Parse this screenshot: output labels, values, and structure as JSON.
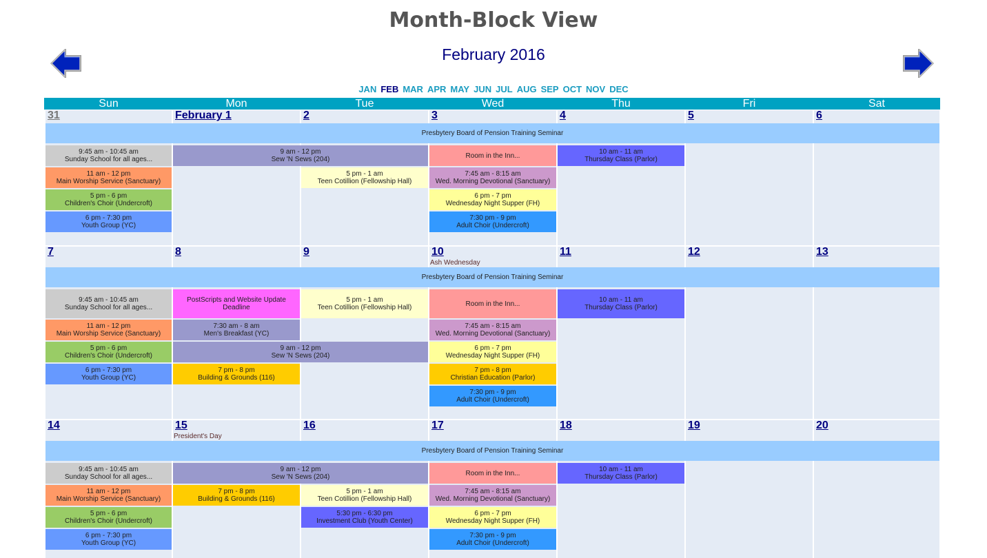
{
  "page": {
    "title": "Month-Block View",
    "month_title": "February 2016"
  },
  "nav": {
    "prev_icon": "left-arrow-icon",
    "next_icon": "right-arrow-icon"
  },
  "months": [
    "JAN",
    "FEB",
    "MAR",
    "APR",
    "MAY",
    "JUN",
    "JUL",
    "AUG",
    "SEP",
    "OCT",
    "NOV",
    "DEC"
  ],
  "current_month": "FEB",
  "weekdays": [
    "Sun",
    "Mon",
    "Tue",
    "Wed",
    "Thu",
    "Fri",
    "Sat"
  ],
  "colors": {
    "header": "#00a2c2",
    "cell": "#e4ebf5",
    "seminar": "#99ccff",
    "gray": "#cccccc",
    "orange": "#ff9966",
    "green": "#99cc66",
    "blue": "#6699ff",
    "lavender": "#9999cc",
    "pink": "#ff9999",
    "violet": "#6666ff",
    "lightyellow": "#ffffcc",
    "mauve": "#cc99cc",
    "yellow": "#ffff99",
    "skyblue": "#3399ff",
    "magenta": "#ff66ff",
    "gold": "#ffcc00"
  },
  "weeks": [
    {
      "days": [
        {
          "label": "31",
          "other": true
        },
        {
          "label": "February 1"
        },
        {
          "label": "2"
        },
        {
          "label": "3"
        },
        {
          "label": "4"
        },
        {
          "label": "5"
        },
        {
          "label": "6"
        }
      ],
      "notes": [],
      "seminar": "Presbytery Board of Pension Training Seminar",
      "events": [
        {
          "col": 0,
          "span": 1,
          "row": 0,
          "color": "gray",
          "time": "9:45 am - 10:45 am",
          "title": "Sunday School for all ages..."
        },
        {
          "col": 0,
          "span": 1,
          "row": 1,
          "color": "orange",
          "time": "11 am - 12 pm",
          "title": "Main Worship Service (Sanctuary)"
        },
        {
          "col": 0,
          "span": 1,
          "row": 2,
          "color": "green",
          "time": "5 pm - 6 pm",
          "title": "Children's Choir (Undercroft)"
        },
        {
          "col": 0,
          "span": 1,
          "row": 3,
          "color": "blue",
          "time": "6 pm - 7:30 pm",
          "title": "Youth Group (YC)"
        },
        {
          "col": 1,
          "span": 2,
          "row": 0,
          "color": "lavender",
          "time": "9 am - 12 pm",
          "title": "Sew 'N Sews (204)"
        },
        {
          "col": 2,
          "span": 1,
          "row": 1,
          "color": "lightyellow",
          "time": "5 pm - 1 am",
          "title": "Teen Cotillion (Fellowship Hall)"
        },
        {
          "col": 3,
          "span": 1,
          "row": 0,
          "color": "pink",
          "time": "",
          "title": "Room in the Inn..."
        },
        {
          "col": 3,
          "span": 1,
          "row": 1,
          "color": "mauve",
          "time": "7:45 am - 8:15 am",
          "title": "Wed. Morning Devotional (Sanctuary)"
        },
        {
          "col": 3,
          "span": 1,
          "row": 2,
          "color": "yellow",
          "time": "6 pm - 7 pm",
          "title": "Wednesday Night Supper (FH)"
        },
        {
          "col": 3,
          "span": 1,
          "row": 3,
          "color": "skyblue",
          "time": "7:30 pm - 9 pm",
          "title": "Adult Choir (Undercroft)"
        },
        {
          "col": 4,
          "span": 1,
          "row": 0,
          "color": "violet",
          "time": "10 am - 11 am",
          "title": "Thursday Class (Parlor)"
        }
      ]
    },
    {
      "days": [
        {
          "label": "7"
        },
        {
          "label": "8"
        },
        {
          "label": "9"
        },
        {
          "label": "10"
        },
        {
          "label": "11"
        },
        {
          "label": "12"
        },
        {
          "label": "13"
        }
      ],
      "notes": [
        {
          "col": 3,
          "text": "Ash Wednesday"
        }
      ],
      "seminar": "Presbytery Board of Pension Training Seminar",
      "events": [
        {
          "col": 0,
          "span": 1,
          "row": 0,
          "color": "gray",
          "time": "9:45 am - 10:45 am",
          "title": "Sunday School for all ages..."
        },
        {
          "col": 0,
          "span": 1,
          "row": 1,
          "color": "orange",
          "time": "11 am - 12 pm",
          "title": "Main Worship Service (Sanctuary)"
        },
        {
          "col": 0,
          "span": 1,
          "row": 2,
          "color": "green",
          "time": "5 pm - 6 pm",
          "title": "Children's Choir (Undercroft)"
        },
        {
          "col": 0,
          "span": 1,
          "row": 3,
          "color": "blue",
          "time": "6 pm - 7:30 pm",
          "title": "Youth Group (YC)"
        },
        {
          "col": 1,
          "span": 1,
          "row": 0,
          "color": "magenta",
          "time": "PostScripts and Website Update",
          "title": "Deadline"
        },
        {
          "col": 1,
          "span": 1,
          "row": 1,
          "color": "lavender",
          "time": "7:30 am - 8 am",
          "title": "Men's Breakfast (YC)"
        },
        {
          "col": 1,
          "span": 2,
          "row": 2,
          "color": "lavender",
          "time": "9 am - 12 pm",
          "title": "Sew 'N Sews (204)"
        },
        {
          "col": 1,
          "span": 1,
          "row": 3,
          "color": "gold",
          "time": "7 pm - 8 pm",
          "title": "Building & Grounds (116)"
        },
        {
          "col": 2,
          "span": 1,
          "row": 0,
          "color": "lightyellow",
          "time": "5 pm - 1 am",
          "title": "Teen Cotillion (Fellowship Hall)"
        },
        {
          "col": 3,
          "span": 1,
          "row": 0,
          "color": "pink",
          "time": "",
          "title": "Room in the Inn..."
        },
        {
          "col": 3,
          "span": 1,
          "row": 1,
          "color": "mauve",
          "time": "7:45 am - 8:15 am",
          "title": "Wed. Morning Devotional (Sanctuary)"
        },
        {
          "col": 3,
          "span": 1,
          "row": 2,
          "color": "yellow",
          "time": "6 pm - 7 pm",
          "title": "Wednesday Night Supper (FH)"
        },
        {
          "col": 3,
          "span": 1,
          "row": 3,
          "color": "gold",
          "time": "7 pm - 8 pm",
          "title": "Christian Education (Parlor)"
        },
        {
          "col": 3,
          "span": 1,
          "row": 4,
          "color": "skyblue",
          "time": "7:30 pm - 9 pm",
          "title": "Adult Choir (Undercroft)"
        },
        {
          "col": 4,
          "span": 1,
          "row": 0,
          "color": "violet",
          "time": "10 am - 11 am",
          "title": "Thursday Class (Parlor)"
        }
      ]
    },
    {
      "days": [
        {
          "label": "14"
        },
        {
          "label": "15"
        },
        {
          "label": "16"
        },
        {
          "label": "17"
        },
        {
          "label": "18"
        },
        {
          "label": "19"
        },
        {
          "label": "20"
        }
      ],
      "notes": [
        {
          "col": 1,
          "text": "President's Day"
        }
      ],
      "seminar": "Presbytery Board of Pension Training Seminar",
      "events": [
        {
          "col": 0,
          "span": 1,
          "row": 0,
          "color": "gray",
          "time": "9:45 am - 10:45 am",
          "title": "Sunday School for all ages..."
        },
        {
          "col": 0,
          "span": 1,
          "row": 1,
          "color": "orange",
          "time": "11 am - 12 pm",
          "title": "Main Worship Service (Sanctuary)"
        },
        {
          "col": 0,
          "span": 1,
          "row": 2,
          "color": "green",
          "time": "5 pm - 6 pm",
          "title": "Children's Choir (Undercroft)"
        },
        {
          "col": 0,
          "span": 1,
          "row": 3,
          "color": "blue",
          "time": "6 pm - 7:30 pm",
          "title": "Youth Group (YC)"
        },
        {
          "col": 1,
          "span": 2,
          "row": 0,
          "color": "lavender",
          "time": "9 am - 12 pm",
          "title": "Sew 'N Sews (204)"
        },
        {
          "col": 1,
          "span": 1,
          "row": 1,
          "color": "gold",
          "time": "7 pm - 8 pm",
          "title": "Building & Grounds (116)"
        },
        {
          "col": 2,
          "span": 1,
          "row": 1,
          "color": "lightyellow",
          "time": "5 pm - 1 am",
          "title": "Teen Cotillion (Fellowship Hall)"
        },
        {
          "col": 2,
          "span": 1,
          "row": 2,
          "color": "violet",
          "time": "5:30 pm - 6:30 pm",
          "title": "Investment Club (Youth Center)"
        },
        {
          "col": 3,
          "span": 1,
          "row": 0,
          "color": "pink",
          "time": "",
          "title": "Room in the Inn..."
        },
        {
          "col": 3,
          "span": 1,
          "row": 1,
          "color": "mauve",
          "time": "7:45 am - 8:15 am",
          "title": "Wed. Morning Devotional (Sanctuary)"
        },
        {
          "col": 3,
          "span": 1,
          "row": 2,
          "color": "yellow",
          "time": "6 pm - 7 pm",
          "title": "Wednesday Night Supper (FH)"
        },
        {
          "col": 3,
          "span": 1,
          "row": 3,
          "color": "skyblue",
          "time": "7:30 pm - 9 pm",
          "title": "Adult Choir (Undercroft)"
        },
        {
          "col": 4,
          "span": 1,
          "row": 0,
          "color": "violet",
          "time": "10 am - 11 am",
          "title": "Thursday Class (Parlor)"
        }
      ]
    }
  ]
}
